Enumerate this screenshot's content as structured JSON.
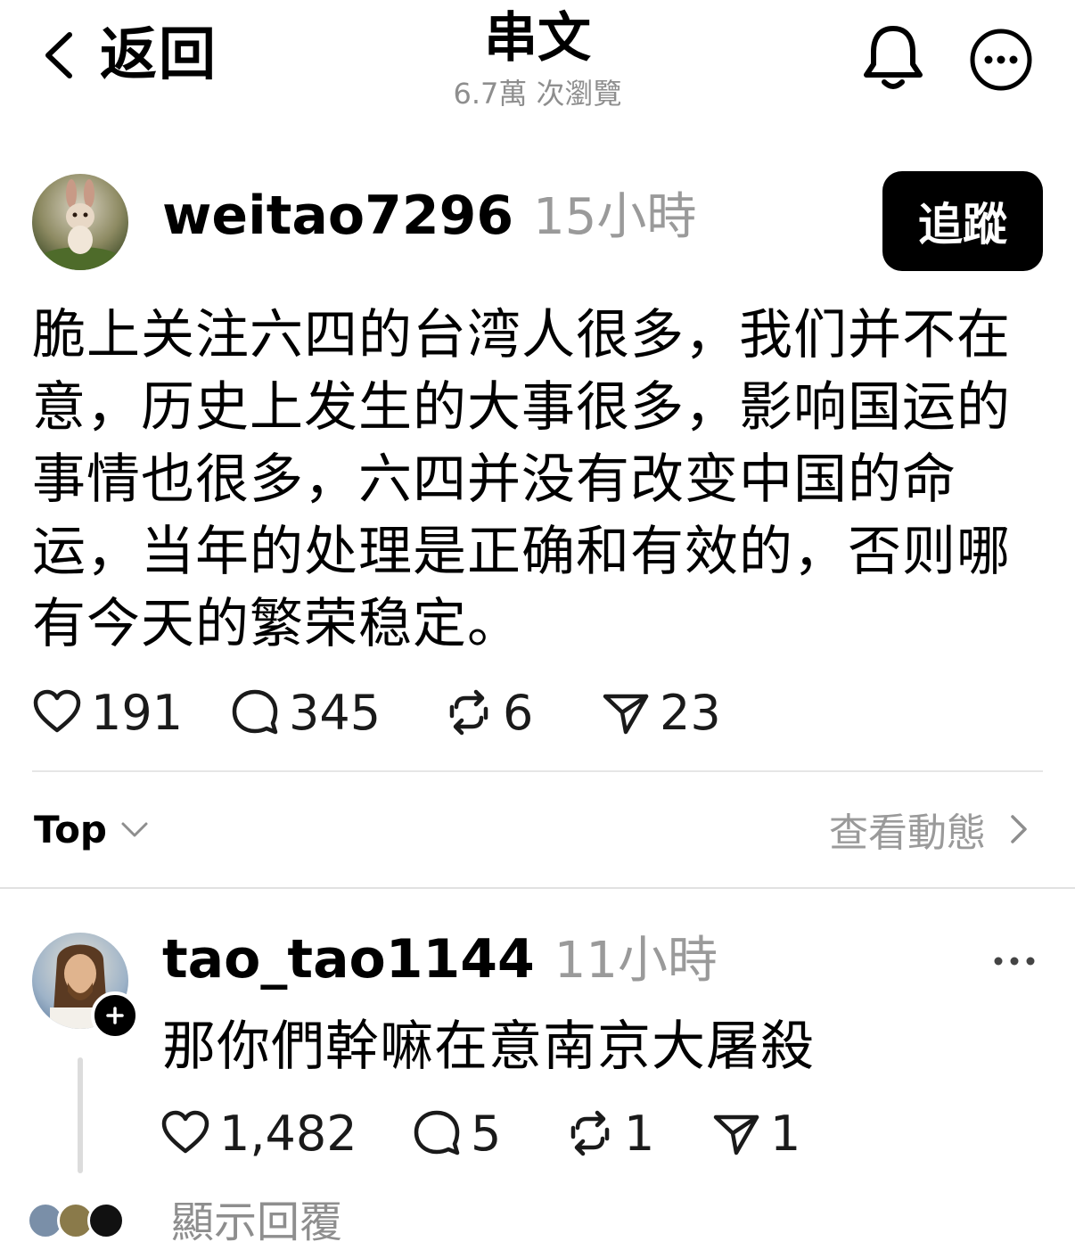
{
  "header": {
    "back_label": "返回",
    "title": "串文",
    "views": "6.7萬 次瀏覽"
  },
  "post": {
    "username": "weitao7296",
    "time": "15小時",
    "follow_label": "追蹤",
    "text": "脆上关注六四的台湾人很多，我们并不在意，历史上发生的大事很多，影响国运的事情也很多，六四并没有改变中国的命运，当年的处理是正确和有效的，否则哪有今天的繁荣稳定。",
    "likes": "191",
    "comments": "345",
    "reposts": "6",
    "shares": "23"
  },
  "replies_section": {
    "sort_label": "Top",
    "activity_label": "查看動態"
  },
  "reply": {
    "username": "tao_tao1144",
    "time": "11小時",
    "text": "那你們幹嘛在意南京大屠殺",
    "likes": "1,482",
    "comments": "5",
    "reposts": "1",
    "shares": "1"
  },
  "more_replies_label": "顯示回覆"
}
